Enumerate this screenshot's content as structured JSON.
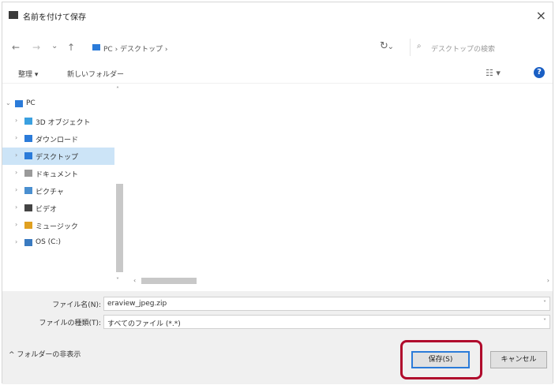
{
  "window": {
    "title": "名前を付けて保存",
    "close": "×"
  },
  "address": {
    "back": "←",
    "forward": "→",
    "down": "⌄",
    "up": "↑",
    "crumbs": "PC › デスクトップ ›",
    "dropdown": "⌄",
    "refresh": "↻",
    "search_icon": "⌕",
    "search_placeholder": "デスクトップの検索"
  },
  "toolbar": {
    "organize": "整理 ▾",
    "new_folder": "新しいフォルダー",
    "view": "☷ ▾",
    "help": "?"
  },
  "tree": [
    {
      "label": "PC",
      "chev": "⌄",
      "icon": "pc-icon",
      "color": "#2b7bd9"
    },
    {
      "label": "3D オブジェクト",
      "chev": "›",
      "icon": "3d-objects-icon",
      "color": "#3aa0e0"
    },
    {
      "label": "ダウンロード",
      "chev": "›",
      "icon": "download-icon",
      "color": "#2b7bd9"
    },
    {
      "label": "デスクトップ",
      "chev": "›",
      "icon": "desktop-icon",
      "color": "#2b7bd9"
    },
    {
      "label": "ドキュメント",
      "chev": "›",
      "icon": "documents-icon",
      "color": "#9a9a9a"
    },
    {
      "label": "ピクチャ",
      "chev": "›",
      "icon": "pictures-icon",
      "color": "#4a8fd0"
    },
    {
      "label": "ビデオ",
      "chev": "›",
      "icon": "videos-icon",
      "color": "#444444"
    },
    {
      "label": "ミュージック",
      "chev": "›",
      "icon": "music-icon",
      "color": "#e0a020"
    },
    {
      "label": "OS (C:)",
      "chev": "›",
      "icon": "drive-icon",
      "color": "#3a7ac0"
    }
  ],
  "scroll": {
    "up": "˄",
    "down": "˅",
    "left": "‹",
    "right": "›"
  },
  "form": {
    "filename_label": "ファイル名(N):",
    "filename_value": "eraview_jpeg.zip",
    "filetype_label": "ファイルの種類(T):",
    "filetype_value": "すべてのファイル (*.*)",
    "chev": "˅"
  },
  "footer": {
    "hide_folders": "^ フォルダーの非表示",
    "save": "保存(S)",
    "cancel": "キャンセル"
  },
  "colors": {
    "highlight": "#b00a2c",
    "accent": "#2b7bd9",
    "selection": "#cce4f7"
  }
}
